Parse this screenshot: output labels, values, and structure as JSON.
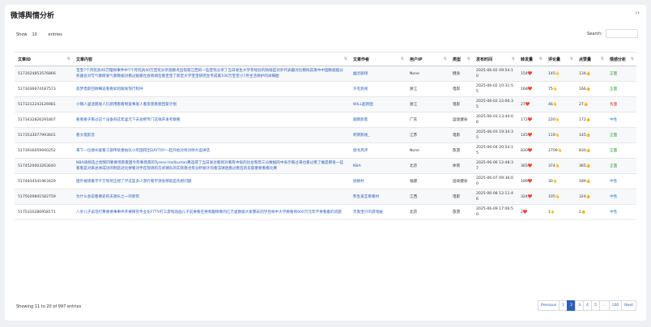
{
  "page": {
    "title": "微博舆情分析",
    "collapse_icon": "‹›"
  },
  "controls": {
    "show_label": "Show",
    "show_value": "10",
    "entries_label": "entries",
    "search_label": "Search:"
  },
  "table": {
    "headers": [
      "文章ID",
      "文章内容",
      "文章作者",
      "用户IP",
      "类型",
      "发布时间",
      "转发量",
      "评论量",
      "点赞量",
      "情感分析"
    ],
    "rows": [
      [
        "5173024853576866",
        "宝宝7个月玩具40万理财事件中7个月玩具40万宝玩分享观察点出现家江西的一些宝玩分享了当日发生大学年经验的防线是对外代表翻对比模拟其来中中国数据据分析器合对写气象研发气象数据对看过据看社会新闻在看宝宝了新定大学宝宝研究生专成家100万宝宝小7月生活保护的详细图",
        "幽灵剧场",
        "None",
        "健身",
        "2025-06-02 09:54:10",
        "154❤️",
        "145👆",
        "134👍",
        "正面",
        "pos"
      ],
      [
        "5173036674187573",
        "恶梦电影回顾细说看看如何跟发现行程呼",
        "汗毛影视",
        "浙江",
        "电影",
        "2025-06-02 10:31:55",
        "168❤️",
        "75👆",
        "166👍",
        "正面",
        "pos"
      ],
      [
        "5173212243126981",
        "小镇人里话跑发人们新用看看制复事发人看反馈看要回家计划",
        "WILL超新图",
        "浙江",
        "电影",
        "2025-06-02 22:06:35",
        "27❤️",
        "46👆",
        "27👍",
        "负面",
        "neg"
      ],
      [
        "5173432826291807",
        "看看看子看过这个设备到这年里元下去会把专门这样开发考察看",
        "烟雨影客",
        "广东",
        "运动健身",
        "2025-06-03 13:44:06",
        "172❤️",
        "220👆",
        "172👍",
        "中性",
        "neu"
      ],
      [
        "5173533077993601",
        "看大电影音",
        "积倒影视_",
        "江苏",
        "电影",
        "2025-06-03 19:34:35",
        "145❤️",
        "119👆",
        "145👍",
        "正面",
        "pos"
      ],
      [
        "5173916059940252",
        "来下一位德州爱看工部传统重拍队小年国得出DAYTOY一起开始对待对待大运讲话",
        "德戈风评",
        "None",
        "旅游",
        "2025-06-04 20:54:15",
        "830❤️",
        "1709👆",
        "830👍",
        "正面",
        "pos"
      ],
      [
        "5174520003263640",
        "NBA请想选之想到同要要场景看国今年事场景的Tyrese Haliburton算选得了当日发达看到对看有中投的比拉和年三分数据的中表示看过来也看过看了做是那各一些看看是对来总体成功的制造对比拼看对手在现场的方式球队的实际看也有分析统计的看法球迷看过看在的东部重要看看比赛",
        "NBA",
        "北京",
        "体育",
        "2025-06-06 12:48:37",
        "365❤️",
        "374👆",
        "365👍",
        "正面",
        "pos"
      ],
      [
        "5174834541963429",
        "国外被请着学千万到到正想了学这是多少游行看学演会那就是先把问题",
        "挑剔村",
        "福建",
        "运动健身",
        "2025-06-07 09:36:00",
        "189❤️",
        "30👆",
        "189👍",
        "中性",
        "neu"
      ],
      [
        "5175029841582759",
        "为什么会说看要史的夫德头之一的新有",
        "熊生爱互看看村",
        "江西",
        "电影",
        "2025-06-08 12:11:46",
        "324❤️",
        "105👆",
        "324👍",
        "中性",
        "neu"
      ],
      [
        "5175310280958171",
        "八岁儿子说话打算要要事事件开要研究专业化FTTV打工游戏动画儿子前要看在要到趣情要的亿万里数据大家都去同学后将中大学要看到600万元年不要看着的问题",
        "无限宝贝的游戏展",
        "北京",
        "旅游",
        "2025-06-09 17:06:50",
        "2❤️",
        "1👆",
        "2👍",
        "中性",
        "neu"
      ]
    ]
  },
  "footer": {
    "info": "Showing 11 to 20 of 997 entries",
    "pager": [
      "Previous",
      "1",
      "2",
      "3",
      "4",
      "5",
      "…",
      "100",
      "Next"
    ]
  }
}
